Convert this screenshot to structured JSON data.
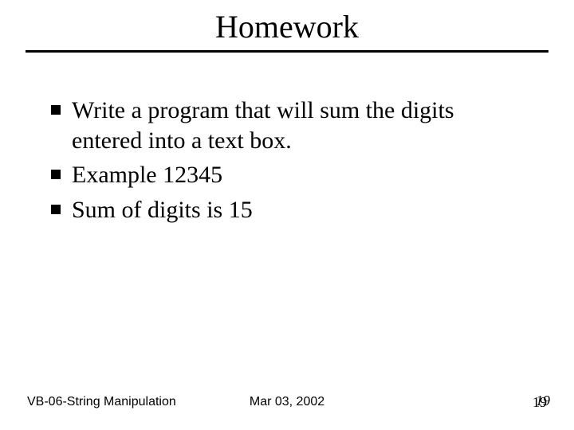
{
  "title": "Homework",
  "bullets": [
    "Write a program that will sum the digits entered into a text box.",
    "Example 12345",
    "Sum of digits is  15"
  ],
  "footer": {
    "left": "VB-06-String Manipulation",
    "center": "Mar 03, 2002",
    "page_a": "19",
    "page_b": "19"
  }
}
